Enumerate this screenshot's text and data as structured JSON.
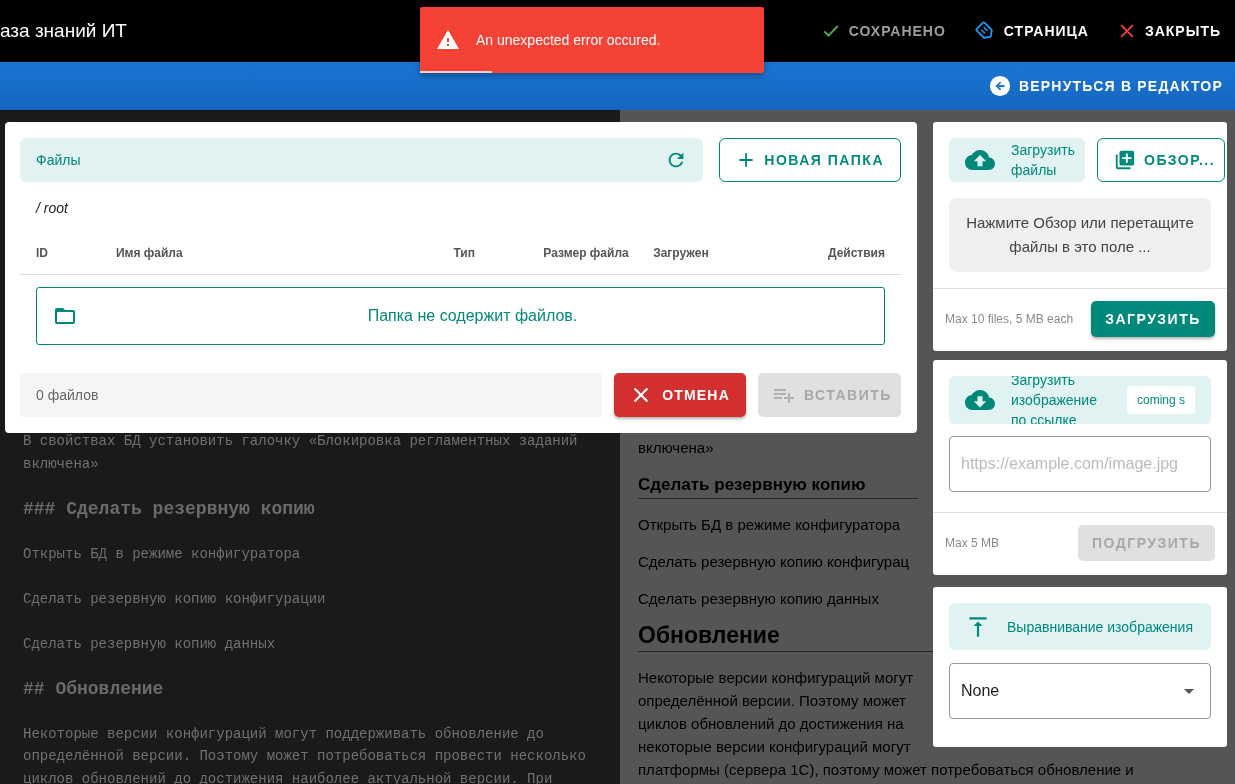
{
  "app_bar": {
    "title": "аза знаний ИТ",
    "actions": [
      {
        "label": "СОХРАНЕНО",
        "kind": "saved"
      },
      {
        "label": "СТРАНИЦА",
        "kind": "page"
      },
      {
        "label": "ЗАКРЫТЬ",
        "kind": "close"
      }
    ]
  },
  "toast": {
    "message": "An unexpected error occured.",
    "level": 0.21
  },
  "sub_bar": {
    "back_button": "ВЕРНУТЬСЯ В РЕДАКТОР"
  },
  "editor": {
    "blocks": [
      {
        "kind": "text",
        "text": "В свойствах БД установить галочку «Блокировка регламентных заданий включена»"
      },
      {
        "kind": "heading",
        "text": "### Сделать резервную копию"
      },
      {
        "kind": "text",
        "text": "Открыть БД в режиме конфигуратора"
      },
      {
        "kind": "text",
        "text": "Сделать резервную копию конфигурации"
      },
      {
        "kind": "text",
        "text": "Сделать резервную копию данных"
      },
      {
        "kind": "heading",
        "text": "## Обновление"
      },
      {
        "kind": "text",
        "text": "Некоторые версии конфигураций могут поддерживать обновление до определённой версии. Поэтому может потребоваться провести несколько циклов обновлений до достижения наиболее актуальной версии. При"
      }
    ]
  },
  "preview": {
    "blocks": [
      {
        "kind": "text",
        "lines": [
          "включена»"
        ]
      },
      {
        "kind": "h3",
        "lines": [
          "Сделать резервную копию"
        ]
      },
      {
        "kind": "text",
        "lines": [
          "Открыть БД в режиме конфигуратора"
        ]
      },
      {
        "kind": "text",
        "lines": [
          "Сделать резервную копию конфигурац"
        ]
      },
      {
        "kind": "text",
        "lines": [
          "Сделать резервную копию данных"
        ]
      },
      {
        "kind": "h2",
        "lines": [
          "Обновление"
        ]
      },
      {
        "kind": "text",
        "lines": [
          "Некоторые версии конфигураций могут",
          "определённой версии. Поэтому может",
          "циклов обновлений до достижения на",
          "некоторые версии конфигураций могут",
          "платформы (сервера 1С), поэтому может потребоваться обновление и"
        ]
      }
    ]
  },
  "file_dialog": {
    "title": "Файлы",
    "new_folder_button": "НОВАЯ ПАПКА",
    "path": "/ root",
    "columns": [
      "ID",
      "Имя файла",
      "Тип",
      "Размер файла",
      "Загружен",
      "Действия"
    ],
    "empty_message": "Папка не содержит файлов.",
    "file_count": "0 файлов",
    "cancel_button": "ОТМЕНА",
    "insert_button": {
      "label": "ВСТАВИТЬ",
      "disabled": true
    }
  },
  "upload_card": {
    "title": "Загрузить файлы",
    "browse_button": "ОБЗОР...",
    "drop_hint": "Нажмите Обзор или перетащите файлы в это поле ...",
    "limit": "Max 10 files, 5 MB each",
    "upload_button": {
      "label": "ЗАГРУЗИТЬ",
      "disabled": false
    }
  },
  "url_card": {
    "title": "Загрузить изображение по ссылке",
    "badge": "coming s",
    "url_field": {
      "placeholder": "https://example.com/image.jpg"
    },
    "limit": "Max 5 MB",
    "fetch_button": {
      "label": "ПОДГРУЗИТЬ",
      "disabled": true
    }
  },
  "align_card": {
    "title": "Выравнивание изображения",
    "select": {
      "value": "None"
    }
  }
}
